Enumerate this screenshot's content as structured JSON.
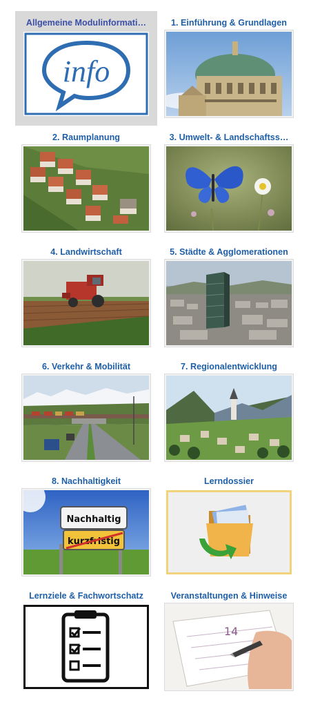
{
  "tiles": [
    {
      "label": "Allgemeine Modulinformati…",
      "icon": "info-speech-bubble-icon",
      "active": true
    },
    {
      "label": "1. Einführung & Grundlagen",
      "icon": "parliament-building-icon"
    },
    {
      "label": "2. Raumplanung",
      "icon": "aerial-houses-icon"
    },
    {
      "label": "3. Umwelt- & Landschaftss…",
      "icon": "blue-butterfly-icon"
    },
    {
      "label": "4. Landwirtschaft",
      "icon": "harvester-field-icon"
    },
    {
      "label": "5. Städte & Agglomerationen",
      "icon": "city-tower-icon"
    },
    {
      "label": "6. Verkehr & Mobilität",
      "icon": "highway-train-icon"
    },
    {
      "label": "7. Regionalentwicklung",
      "icon": "alpine-village-icon"
    },
    {
      "label": "8. Nachhaltigkeit",
      "icon": "road-sign-icon"
    },
    {
      "label": "Lerndossier",
      "icon": "folder-icon"
    },
    {
      "label": "Lernziele & Fachwortschatz",
      "icon": "checklist-clipboard-icon"
    },
    {
      "label": "Veranstaltungen & Hinweise",
      "icon": "calendar-pen-icon"
    }
  ],
  "images": {
    "info_text": "info",
    "sign_top": "Nachhaltig",
    "sign_bottom": "kurzfristig",
    "calendar_day": "14"
  },
  "colors": {
    "title_blue": "#1f5fa8",
    "active_title": "#3b4fa6",
    "active_bg": "#d9d9d9"
  }
}
